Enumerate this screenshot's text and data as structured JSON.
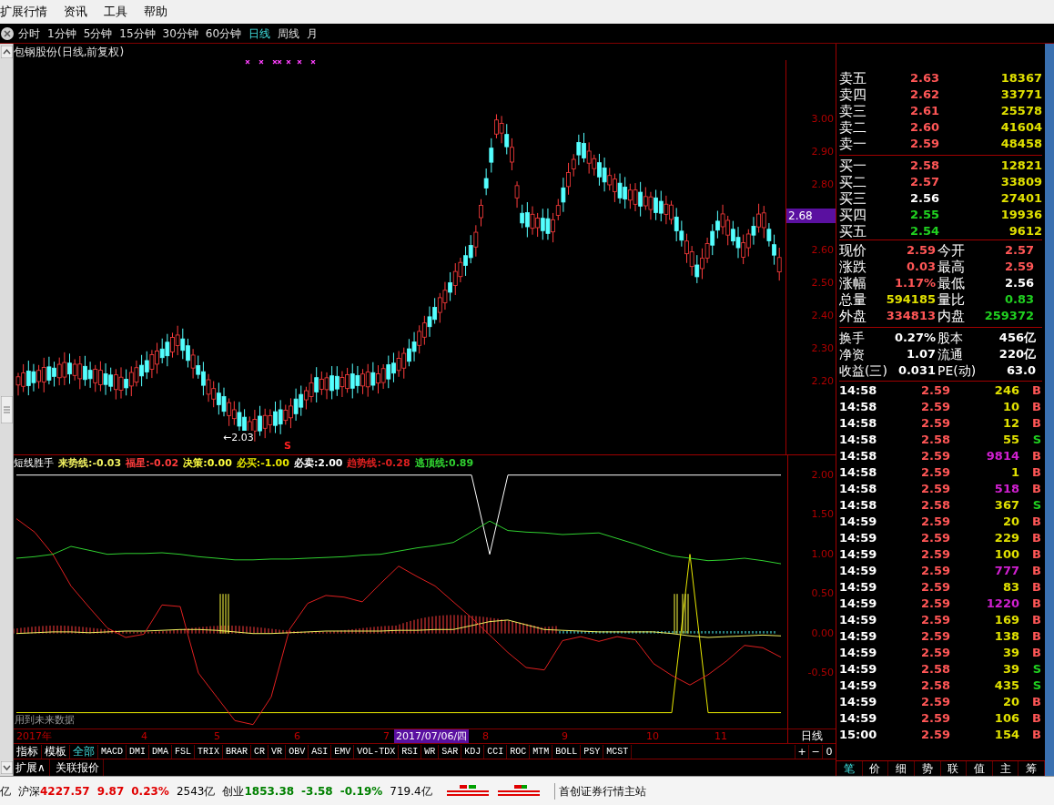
{
  "menu": [
    {
      "label": "扩展行情"
    },
    {
      "label": "资讯"
    },
    {
      "label": "工具"
    },
    {
      "label": "帮助"
    }
  ],
  "periods": [
    {
      "label": "分时",
      "selected": false
    },
    {
      "label": "1分钟",
      "selected": false
    },
    {
      "label": "5分钟",
      "selected": false
    },
    {
      "label": "15分钟",
      "selected": false
    },
    {
      "label": "30分钟",
      "selected": false
    },
    {
      "label": "60分钟",
      "selected": false
    },
    {
      "label": "日线",
      "selected": true
    },
    {
      "label": "周线",
      "selected": false
    },
    {
      "label": "月",
      "selected": false
    }
  ],
  "chart_title": "包钢股份(日线,前复权)",
  "price_axis": {
    "labels": [
      "3.00",
      "2.90",
      "2.80",
      "2.60",
      "2.50",
      "2.40",
      "2.30",
      "2.20"
    ],
    "current_price": "2.68",
    "low_label": "←2.03",
    "sell_marker": "S"
  },
  "indicator": {
    "name": "短线胜手",
    "note": "用到未来数据",
    "legend": [
      {
        "kind": "series",
        "value": "-0.03"
      },
      {
        "kind": "extra",
        "label": "福星:",
        "value": "-0.02",
        "color": "#ff3c3c"
      },
      {
        "kind": "extra",
        "label": "决策:",
        "value": "0.00",
        "color": "#ffff40"
      },
      {
        "kind": "series",
        "value": "-1.00"
      },
      {
        "kind": "series",
        "value": "2.00"
      },
      {
        "kind": "series",
        "value": "-0.28"
      },
      {
        "kind": "series",
        "value": "0.89"
      }
    ],
    "chart_data": {
      "type": "line",
      "ylim": [
        -1.2,
        2.25
      ],
      "yticks": [
        {
          "value": 2,
          "label": "2.00"
        },
        {
          "value": 1.5,
          "label": "1.50"
        },
        {
          "value": 1,
          "label": "1.00"
        },
        {
          "value": 0.5,
          "label": "0.50"
        },
        {
          "value": 0,
          "label": "0.00"
        },
        {
          "value": -0.5,
          "label": "-0.50"
        }
      ],
      "series": [
        {
          "name": "来势线:",
          "color": "#f0f060",
          "values": [
            0.0,
            0.01,
            0.02,
            0.02,
            0.01,
            0.02,
            0.03,
            0.03,
            0.04,
            0.05,
            0.05,
            0.04,
            0.02,
            0.0,
            0.0,
            0.01,
            0.02,
            0.03,
            0.03,
            0.03,
            0.03,
            0.04,
            0.04,
            0.05,
            0.05,
            0.1,
            0.15,
            0.17,
            0.11,
            0.05,
            0.04,
            0.03,
            0.02,
            0.02,
            0.02,
            0.02,
            0.0,
            -0.03,
            -0.05,
            -0.04,
            -0.03,
            -0.02,
            -0.03
          ]
        },
        {
          "name": "必买:",
          "color": "#e8e800",
          "values": [
            -1,
            -1,
            -1,
            -1,
            -1,
            -1,
            -1,
            -1,
            -1,
            -1,
            -1,
            -1,
            -1,
            -1,
            -1,
            -1,
            -1,
            -1,
            -1,
            -1,
            -1,
            -1,
            -1,
            -1,
            -1,
            -1,
            -1,
            -1,
            -1,
            -1,
            -1,
            -1,
            -1,
            -1,
            -1,
            -1,
            -1,
            1,
            -1,
            -1,
            -1,
            -1,
            -1
          ]
        },
        {
          "name": "必卖:",
          "color": "#ffffff",
          "values": [
            2,
            2,
            2,
            2,
            2,
            2,
            2,
            2,
            2,
            2,
            2,
            2,
            2,
            2,
            2,
            2,
            2,
            2,
            2,
            2,
            2,
            2,
            2,
            2,
            2,
            2,
            1,
            2,
            2,
            2,
            2,
            2,
            2,
            2,
            2,
            2,
            2,
            2,
            2,
            2,
            2,
            2,
            2
          ]
        },
        {
          "name": "趋势线:",
          "color": "#e02020",
          "values": [
            1.45,
            1.28,
            1.0,
            0.6,
            0.33,
            0.07,
            -0.05,
            -0.01,
            0.36,
            0.34,
            -0.5,
            -0.8,
            -1.1,
            -1.15,
            -0.8,
            0.05,
            0.38,
            0.48,
            0.46,
            0.4,
            0.63,
            0.85,
            0.72,
            0.6,
            0.4,
            0.2,
            -0.02,
            -0.24,
            -0.43,
            -0.46,
            -0.09,
            -0.04,
            -0.1,
            -0.04,
            -0.08,
            -0.38,
            -0.53,
            -0.65,
            -0.52,
            -0.35,
            -0.15,
            -0.18,
            -0.3
          ]
        },
        {
          "name": "逃顶线:",
          "color": "#30d030",
          "values": [
            0.95,
            0.97,
            1.0,
            1.1,
            1.05,
            1.0,
            1.01,
            1.01,
            1.02,
            1.0,
            0.97,
            0.95,
            0.93,
            0.93,
            0.94,
            0.94,
            0.95,
            0.96,
            0.97,
            0.99,
            1.0,
            1.04,
            1.08,
            1.11,
            1.15,
            1.28,
            1.42,
            1.3,
            1.28,
            1.27,
            1.25,
            1.26,
            1.27,
            1.2,
            1.13,
            1.05,
            0.98,
            0.95,
            0.92,
            0.93,
            0.95,
            0.92,
            0.88
          ]
        }
      ]
    }
  },
  "date_axis": {
    "labels": [
      "2017年",
      "4",
      "5",
      "6",
      "7",
      "8",
      "9",
      "10",
      "11"
    ],
    "cursor_date": "2017/07/06/四",
    "period": "日线"
  },
  "indicator_tabs": [
    {
      "label": "指标",
      "selected": false
    },
    {
      "label": "模板",
      "selected": false
    },
    {
      "label": "全部",
      "selected": true
    },
    {
      "label": "MACD",
      "selected": false
    },
    {
      "label": "DMI",
      "selected": false
    },
    {
      "label": "DMA",
      "selected": false
    },
    {
      "label": "FSL",
      "selected": false
    },
    {
      "label": "TRIX",
      "selected": false
    },
    {
      "label": "BRAR",
      "selected": false
    },
    {
      "label": "CR",
      "selected": false
    },
    {
      "label": "VR",
      "selected": false
    },
    {
      "label": "OBV",
      "selected": false
    },
    {
      "label": "ASI",
      "selected": false
    },
    {
      "label": "EMV",
      "selected": false
    },
    {
      "label": "VOL-TDX",
      "selected": false
    },
    {
      "label": "RSI",
      "selected": false
    },
    {
      "label": "WR",
      "selected": false
    },
    {
      "label": "SAR",
      "selected": false
    },
    {
      "label": "KDJ",
      "selected": false
    },
    {
      "label": "CCI",
      "selected": false
    },
    {
      "label": "ROC",
      "selected": false
    },
    {
      "label": "MTM",
      "selected": false
    },
    {
      "label": "BOLL",
      "selected": false
    },
    {
      "label": "PSY",
      "selected": false
    },
    {
      "label": "MCST",
      "selected": false
    }
  ],
  "zoom_buttons": [
    "+",
    "−",
    "0"
  ],
  "links": [
    "扩展∧",
    "关联报价"
  ],
  "asks": [
    {
      "label": "卖五",
      "price": "2.63",
      "volume": "18367",
      "color": "#ff5656"
    },
    {
      "label": "卖四",
      "price": "2.62",
      "volume": "33771",
      "color": "#ff5656"
    },
    {
      "label": "卖三",
      "price": "2.61",
      "volume": "25578",
      "color": "#ff5656"
    },
    {
      "label": "卖二",
      "price": "2.60",
      "volume": "41604",
      "color": "#ff5656"
    },
    {
      "label": "卖一",
      "price": "2.59",
      "volume": "48458",
      "color": "#ff5656"
    }
  ],
  "bids": [
    {
      "label": "买一",
      "price": "2.58",
      "volume": "12821",
      "color": "#ff5656"
    },
    {
      "label": "买二",
      "price": "2.57",
      "volume": "33809",
      "color": "#ff5656"
    },
    {
      "label": "买三",
      "price": "2.56",
      "volume": "27401",
      "color": "#ffffff"
    },
    {
      "label": "买四",
      "price": "2.55",
      "volume": "19936",
      "color": "#20d020"
    },
    {
      "label": "买五",
      "price": "2.54",
      "volume": "9612",
      "color": "#20d020"
    }
  ],
  "quote": [
    [
      {
        "label": "现价",
        "value": "2.59",
        "color": "#ff5656"
      },
      {
        "label": "今开",
        "value": "2.57",
        "color": "#ff5656"
      }
    ],
    [
      {
        "label": "涨跌",
        "value": "0.03",
        "color": "#ff5656"
      },
      {
        "label": "最高",
        "value": "2.59",
        "color": "#ff5656"
      }
    ],
    [
      {
        "label": "涨幅",
        "value": "1.17%",
        "color": "#ff5656"
      },
      {
        "label": "最低",
        "value": "2.56",
        "color": "#ffffff"
      }
    ],
    [
      {
        "label": "总量",
        "value": "594185",
        "color": "#e0e000"
      },
      {
        "label": "量比",
        "value": "0.83",
        "color": "#20d020"
      }
    ],
    [
      {
        "label": "外盘",
        "value": "334813",
        "color": "#ff5656"
      },
      {
        "label": "内盘",
        "value": "259372",
        "color": "#20d020"
      }
    ]
  ],
  "fundamentals": [
    [
      {
        "label": "换手",
        "value": "0.27%"
      },
      {
        "label": "股本",
        "value": "456亿"
      }
    ],
    [
      {
        "label": "净资",
        "value": "1.07"
      },
      {
        "label": "流通",
        "value": "220亿"
      }
    ],
    [
      {
        "label": "收益(三)",
        "value": "0.031"
      },
      {
        "label": "PE(动)",
        "value": "63.0"
      }
    ]
  ],
  "trades": [
    {
      "time": "14:58",
      "price": "2.59",
      "volume": "246",
      "large": false,
      "side": "B",
      "color": "#ff5656"
    },
    {
      "time": "14:58",
      "price": "2.59",
      "volume": "10",
      "large": false,
      "side": "B",
      "color": "#ff5656"
    },
    {
      "time": "14:58",
      "price": "2.59",
      "volume": "12",
      "large": false,
      "side": "B",
      "color": "#ff5656"
    },
    {
      "time": "14:58",
      "price": "2.58",
      "volume": "55",
      "large": false,
      "side": "S",
      "color": "#20d020"
    },
    {
      "time": "14:58",
      "price": "2.59",
      "volume": "9814",
      "large": true,
      "side": "B",
      "color": "#ff5656"
    },
    {
      "time": "14:58",
      "price": "2.59",
      "volume": "1",
      "large": false,
      "side": "B",
      "color": "#ff5656"
    },
    {
      "time": "14:58",
      "price": "2.59",
      "volume": "518",
      "large": true,
      "side": "B",
      "color": "#ff5656"
    },
    {
      "time": "14:58",
      "price": "2.58",
      "volume": "367",
      "large": false,
      "side": "S",
      "color": "#20d020"
    },
    {
      "time": "14:59",
      "price": "2.59",
      "volume": "20",
      "large": false,
      "side": "B",
      "color": "#ff5656"
    },
    {
      "time": "14:59",
      "price": "2.59",
      "volume": "229",
      "large": false,
      "side": "B",
      "color": "#ff5656"
    },
    {
      "time": "14:59",
      "price": "2.59",
      "volume": "100",
      "large": false,
      "side": "B",
      "color": "#ff5656"
    },
    {
      "time": "14:59",
      "price": "2.59",
      "volume": "777",
      "large": true,
      "side": "B",
      "color": "#ff5656"
    },
    {
      "time": "14:59",
      "price": "2.59",
      "volume": "83",
      "large": false,
      "side": "B",
      "color": "#ff5656"
    },
    {
      "time": "14:59",
      "price": "2.59",
      "volume": "1220",
      "large": true,
      "side": "B",
      "color": "#ff5656"
    },
    {
      "time": "14:59",
      "price": "2.59",
      "volume": "169",
      "large": false,
      "side": "B",
      "color": "#ff5656"
    },
    {
      "time": "14:59",
      "price": "2.59",
      "volume": "138",
      "large": false,
      "side": "B",
      "color": "#ff5656"
    },
    {
      "time": "14:59",
      "price": "2.59",
      "volume": "39",
      "large": false,
      "side": "B",
      "color": "#ff5656"
    },
    {
      "time": "14:59",
      "price": "2.58",
      "volume": "39",
      "large": false,
      "side": "S",
      "color": "#20d020"
    },
    {
      "time": "14:59",
      "price": "2.58",
      "volume": "435",
      "large": false,
      "side": "S",
      "color": "#20d020"
    },
    {
      "time": "14:59",
      "price": "2.59",
      "volume": "20",
      "large": false,
      "side": "B",
      "color": "#ff5656"
    },
    {
      "time": "14:59",
      "price": "2.59",
      "volume": "106",
      "large": false,
      "side": "B",
      "color": "#ff5656"
    },
    {
      "time": "15:00",
      "price": "2.59",
      "volume": "154",
      "large": false,
      "side": "B",
      "color": "#ff5656"
    }
  ],
  "panel_tabs": [
    {
      "label": "笔",
      "selected": true
    },
    {
      "label": "价",
      "selected": false
    },
    {
      "label": "细",
      "selected": false
    },
    {
      "label": "势",
      "selected": false
    },
    {
      "label": "联",
      "selected": false
    },
    {
      "label": "值",
      "selected": false
    },
    {
      "label": "主",
      "selected": false
    },
    {
      "label": "筹",
      "selected": false
    }
  ],
  "status_bar": {
    "lead": "亿",
    "indices": [
      {
        "name": "沪深",
        "value": "4227.57",
        "change": "9.87",
        "percent": "0.23%",
        "amount": "2543亿",
        "color": "#e00000"
      },
      {
        "name": "创业",
        "value": "1853.38",
        "change": "-3.58",
        "percent": "-0.19%",
        "amount": "719.4亿",
        "color": "#008000"
      }
    ],
    "server": "首创证券行情主站"
  }
}
